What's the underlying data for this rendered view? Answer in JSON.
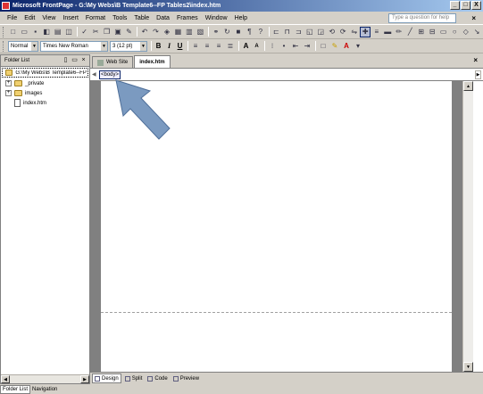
{
  "window": {
    "title": "Microsoft FrontPage - G:\\My Webs\\B Template6--FP Tables2\\index.htm",
    "buttons": {
      "minimize": "_",
      "restore": "□",
      "close": "X"
    }
  },
  "menubar": {
    "items": [
      "File",
      "Edit",
      "View",
      "Insert",
      "Format",
      "Tools",
      "Table",
      "Data",
      "Frames",
      "Window",
      "Help"
    ],
    "help_placeholder": "Type a question for help",
    "close_label": "×"
  },
  "format_toolbar": {
    "style": "Normal",
    "font": "Times New Roman",
    "size": "3  (12 pt)",
    "bold": "B",
    "italic": "I",
    "underline": "U",
    "grow_font": "A",
    "shrink_font": "A"
  },
  "folder_list": {
    "title": "Folder List",
    "close_label": "×",
    "root": "G:\\My Webs\\B Template6--FP Tal",
    "items": [
      {
        "label": "_private",
        "type": "folder"
      },
      {
        "label": "images",
        "type": "folder"
      },
      {
        "label": "index.htm",
        "type": "file"
      }
    ]
  },
  "document": {
    "tabs": [
      "Web Site",
      "index.htm"
    ],
    "active_tab": "index.htm",
    "close_label": "×",
    "tag_selector": "<body>"
  },
  "view_bar": {
    "buttons": [
      "Design",
      "Split",
      "Code",
      "Preview"
    ],
    "active": "Design"
  },
  "bottom_tabs": {
    "items": [
      "Folder List",
      "Navigation"
    ],
    "active": "Folder List"
  },
  "colors": {
    "titlebar_start": "#0a246a",
    "titlebar_end": "#a6caf0",
    "chrome": "#d4d0c8",
    "pointer_fill": "#7b9ac0"
  }
}
